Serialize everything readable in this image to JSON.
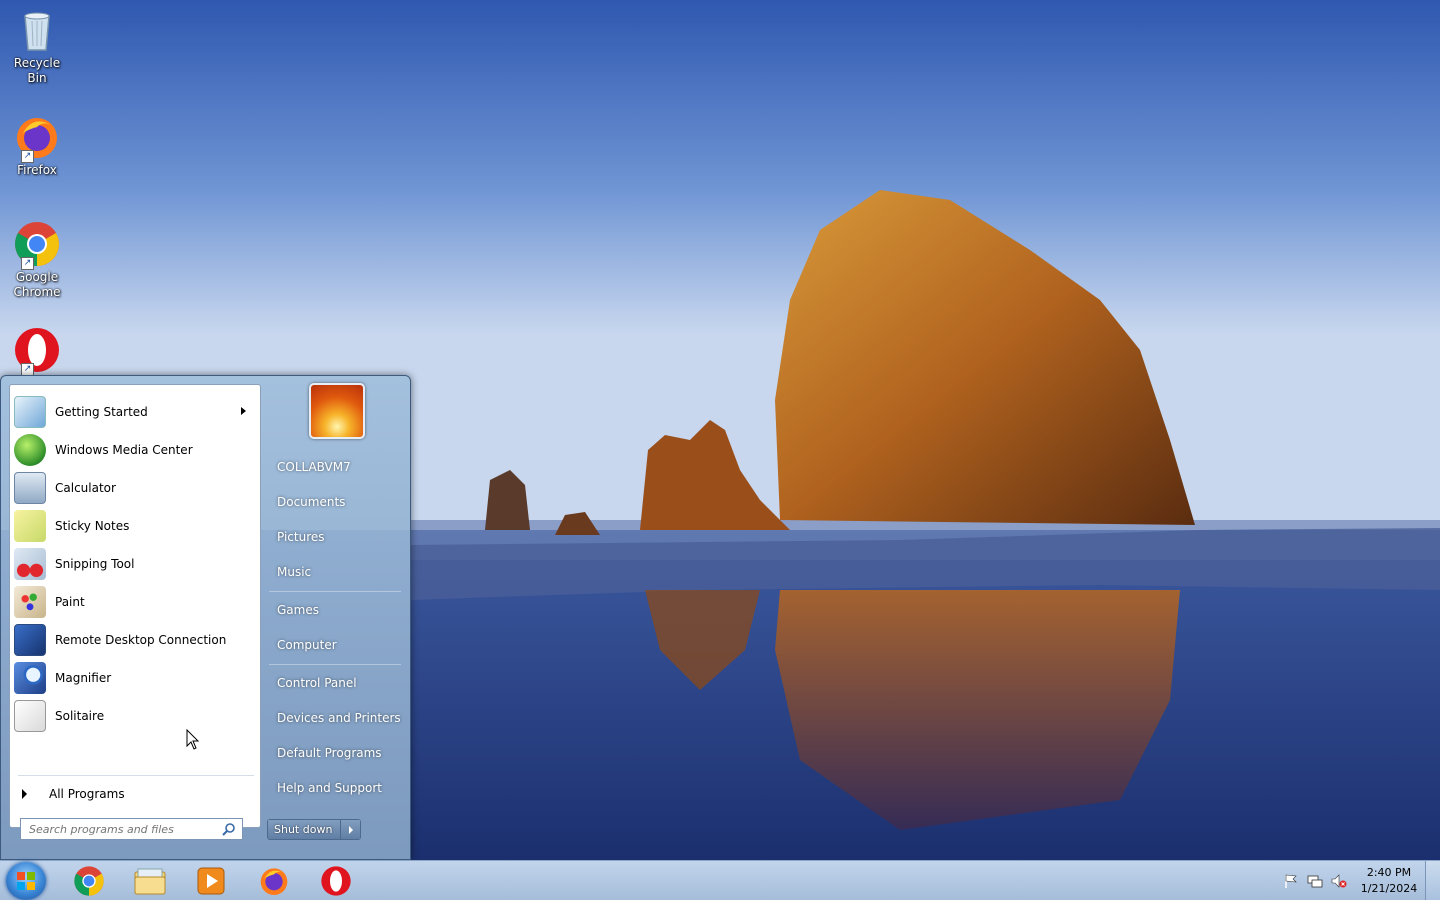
{
  "desktop": {
    "icons": [
      {
        "label": "Recycle Bin",
        "icon": "recycle-bin-icon"
      },
      {
        "label": "Firefox",
        "icon": "firefox-icon"
      },
      {
        "label": "Google Chrome",
        "icon": "chrome-icon"
      },
      {
        "label": "",
        "icon": "opera-icon"
      }
    ]
  },
  "start_menu": {
    "programs": [
      {
        "label": "Getting Started",
        "icon": "getting-started-icon",
        "has_submenu": true
      },
      {
        "label": "Windows Media Center",
        "icon": "media-center-icon"
      },
      {
        "label": "Calculator",
        "icon": "calculator-icon"
      },
      {
        "label": "Sticky Notes",
        "icon": "sticky-notes-icon"
      },
      {
        "label": "Snipping Tool",
        "icon": "snipping-tool-icon"
      },
      {
        "label": "Paint",
        "icon": "paint-icon"
      },
      {
        "label": "Remote Desktop Connection",
        "icon": "remote-desktop-icon"
      },
      {
        "label": "Magnifier",
        "icon": "magnifier-icon"
      },
      {
        "label": "Solitaire",
        "icon": "solitaire-icon"
      }
    ],
    "all_programs": "All Programs",
    "search_placeholder": "Search programs and files",
    "right_pane": {
      "user": "COLLABVM7",
      "items_group1": [
        "Documents",
        "Pictures",
        "Music"
      ],
      "items_group2": [
        "Games",
        "Computer"
      ],
      "items_group3": [
        "Control Panel",
        "Devices and Printers",
        "Default Programs",
        "Help and Support"
      ]
    },
    "shutdown_label": "Shut down"
  },
  "taskbar": {
    "pinned": [
      "chrome-icon",
      "explorer-icon",
      "media-player-icon",
      "firefox-icon",
      "opera-icon"
    ],
    "tray_icons": [
      "flag-icon",
      "network-icon",
      "volume-muted-icon"
    ],
    "time": "2:40 PM",
    "date": "1/21/2024"
  }
}
